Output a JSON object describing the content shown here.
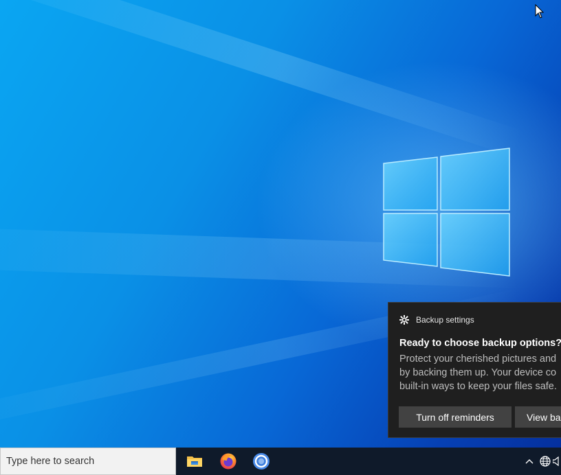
{
  "colors": {
    "desktop_accent": "#0a90e6",
    "toast_background": "#1f1f1f",
    "toast_button": "#424242",
    "taskbar": "#0f1a2a"
  },
  "toast": {
    "app_name": "Backup settings",
    "app_icon": "gear-icon",
    "title": "Ready to choose backup options?",
    "body_lines": [
      "Protect your cherished pictures and",
      "by backing them up. Your device co",
      "built-in ways to keep your files safe."
    ],
    "buttons": [
      "Turn off reminders",
      "View ba"
    ]
  },
  "taskbar": {
    "search_placeholder": "Type here to search",
    "pinned": [
      "file-explorer-icon",
      "firefox-icon",
      "chrome-icon"
    ],
    "tray": [
      "chevron-up-icon",
      "network-globe-icon",
      "speaker-icon"
    ]
  }
}
